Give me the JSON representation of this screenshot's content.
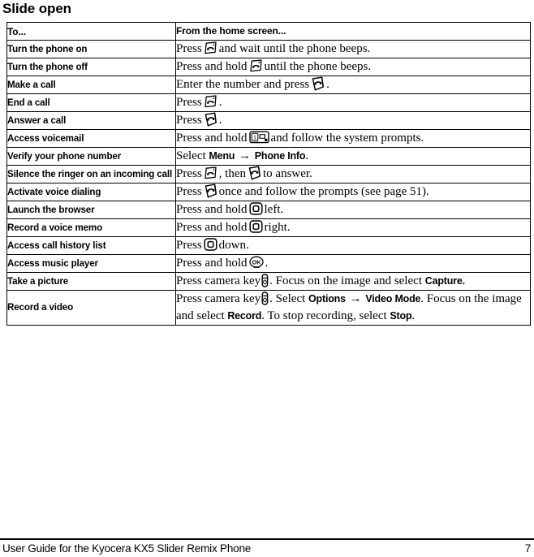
{
  "page": {
    "heading": "Slide open",
    "footer_text": "User Guide for the Kyocera KX5 Slider Remix Phone",
    "footer_page": "7"
  },
  "table": {
    "columns": {
      "to": "To...",
      "how": "From the home screen..."
    },
    "rows": [
      {
        "to": "Turn the phone on",
        "how_pre": "Press",
        "icon": "end-key-icon",
        "how_post": "and wait until the phone beeps."
      },
      {
        "to": "Turn the phone off",
        "how_pre": "Press and hold",
        "icon": "end-key-icon",
        "how_post": "until the phone beeps."
      },
      {
        "to": "Make a call",
        "how_pre": "Enter the number and press",
        "icon": "send-key-icon",
        "how_post": "."
      },
      {
        "to": "End a call",
        "how_pre": "Press",
        "icon": "end-key-icon",
        "how_post": "."
      },
      {
        "to": "Answer a call",
        "how_pre": "Press",
        "icon": "send-key-icon",
        "how_post": "."
      },
      {
        "to": "Access voicemail",
        "how_pre": "Press and hold",
        "icon": "voicemail-key-icon",
        "how_post": "and follow the system prompts."
      },
      {
        "to": "Verify your phone number",
        "how_pre": "Select",
        "term1": "Menu",
        "arrow": "→",
        "term2": "Phone Info",
        "how_post": "."
      },
      {
        "to": "Silence the ringer on an incoming call",
        "how_pre": "Press",
        "icon": "end-key-icon",
        "how_mid": ", then",
        "icon2": "send-key-icon",
        "how_post": "to answer."
      },
      {
        "to": "Activate voice dialing",
        "how_pre": "Press",
        "icon": "send-key-icon",
        "how_post": "once and follow the prompts (see page 51)."
      },
      {
        "to": "Launch the browser",
        "how_pre": "Press and hold",
        "icon": "navigation-key-icon",
        "how_post": "left."
      },
      {
        "to": "Record a voice memo",
        "how_pre": "Press and hold",
        "icon": "navigation-key-icon",
        "how_post": "right."
      },
      {
        "to": "Access call history list",
        "how_pre": "Press",
        "icon": "navigation-key-icon",
        "how_post": "down."
      },
      {
        "to": "Access music player",
        "how_pre": "Press and hold",
        "icon": "ok-key-icon",
        "how_post": "."
      },
      {
        "to": "Take a picture",
        "how_pre": "Press camera key",
        "icon": "camera-key-icon",
        "how_mid": ". Focus on the image and select",
        "term1": "Capture.",
        "how_post": ""
      },
      {
        "to": "Record a video",
        "how_pre": "Press camera key",
        "icon": "camera-key-icon",
        "how_mid": ". Select",
        "term1": "Options",
        "arrow": "→",
        "term2": "Video Mode",
        "how_mid2": ". Focus on the image and select",
        "term3": "Record",
        "how_mid3": ". To stop recording, select",
        "term4": "Stop",
        "how_post": "."
      }
    ]
  },
  "colors": {
    "ink": "#000000",
    "paper": "#ffffff"
  }
}
